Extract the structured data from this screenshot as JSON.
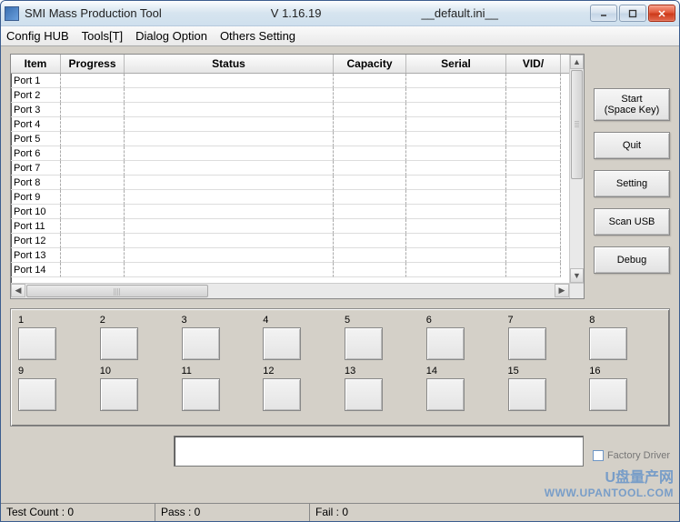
{
  "titlebar": {
    "app_name": "SMI Mass Production Tool",
    "version": "V 1.16.19",
    "config_file": "__default.ini__"
  },
  "menubar": {
    "config_hub": "Config HUB",
    "tools": "Tools[T]",
    "dialog_option": "Dialog Option",
    "others_setting": "Others Setting"
  },
  "grid": {
    "headers": {
      "item": "Item",
      "progress": "Progress",
      "status": "Status",
      "capacity": "Capacity",
      "serial": "Serial",
      "vid": "VID/"
    },
    "rows": [
      {
        "item": "Port 1",
        "progress": "",
        "status": "",
        "capacity": "",
        "serial": "",
        "vid": ""
      },
      {
        "item": "Port 2",
        "progress": "",
        "status": "",
        "capacity": "",
        "serial": "",
        "vid": ""
      },
      {
        "item": "Port 3",
        "progress": "",
        "status": "",
        "capacity": "",
        "serial": "",
        "vid": ""
      },
      {
        "item": "Port 4",
        "progress": "",
        "status": "",
        "capacity": "",
        "serial": "",
        "vid": ""
      },
      {
        "item": "Port 5",
        "progress": "",
        "status": "",
        "capacity": "",
        "serial": "",
        "vid": ""
      },
      {
        "item": "Port 6",
        "progress": "",
        "status": "",
        "capacity": "",
        "serial": "",
        "vid": ""
      },
      {
        "item": "Port 7",
        "progress": "",
        "status": "",
        "capacity": "",
        "serial": "",
        "vid": ""
      },
      {
        "item": "Port 8",
        "progress": "",
        "status": "",
        "capacity": "",
        "serial": "",
        "vid": ""
      },
      {
        "item": "Port 9",
        "progress": "",
        "status": "",
        "capacity": "",
        "serial": "",
        "vid": ""
      },
      {
        "item": "Port 10",
        "progress": "",
        "status": "",
        "capacity": "",
        "serial": "",
        "vid": ""
      },
      {
        "item": "Port 11",
        "progress": "",
        "status": "",
        "capacity": "",
        "serial": "",
        "vid": ""
      },
      {
        "item": "Port 12",
        "progress": "",
        "status": "",
        "capacity": "",
        "serial": "",
        "vid": ""
      },
      {
        "item": "Port 13",
        "progress": "",
        "status": "",
        "capacity": "",
        "serial": "",
        "vid": ""
      },
      {
        "item": "Port 14",
        "progress": "",
        "status": "",
        "capacity": "",
        "serial": "",
        "vid": ""
      }
    ]
  },
  "side_buttons": {
    "start": "Start\n(Space Key)",
    "quit": "Quit",
    "setting": "Setting",
    "scan_usb": "Scan USB",
    "debug": "Debug"
  },
  "ports": {
    "labels": [
      "1",
      "2",
      "3",
      "4",
      "5",
      "6",
      "7",
      "8",
      "9",
      "10",
      "11",
      "12",
      "13",
      "14",
      "15",
      "16"
    ]
  },
  "driver_checkbox": "Factory Driver",
  "statusbar": {
    "test_count": "Test Count : 0",
    "pass": "Pass : 0",
    "fail": "Fail : 0"
  },
  "watermark": {
    "line1": "U盘量产网",
    "line2": "WWW.UPANTOOL.COM"
  }
}
